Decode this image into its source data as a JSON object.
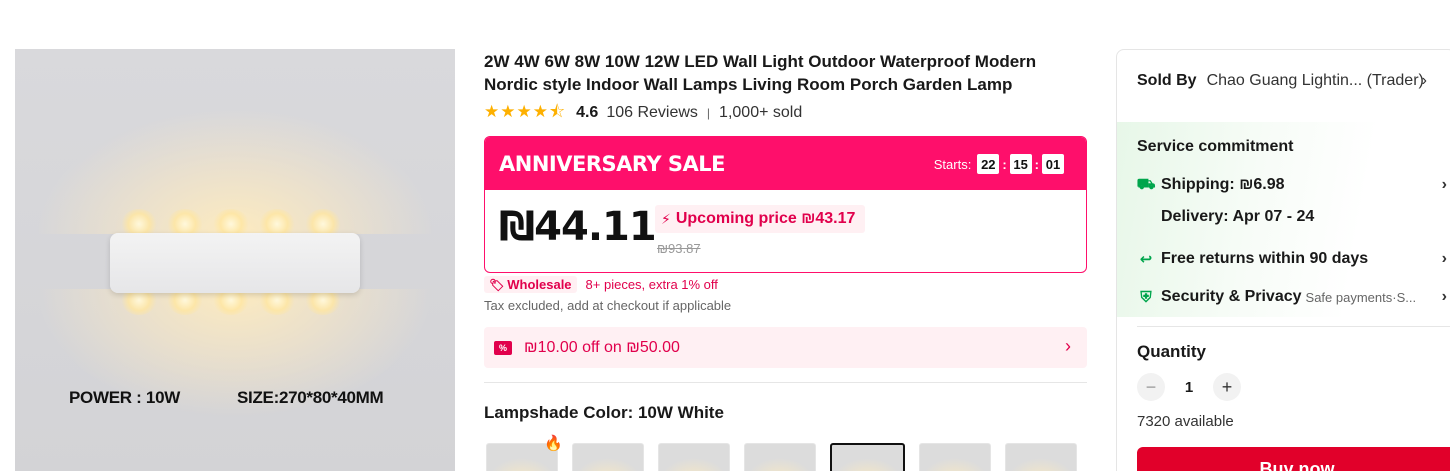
{
  "product_image": {
    "caption_power": "POWER : 10W",
    "caption_size": "SIZE:270*80*40MM"
  },
  "product": {
    "title": "2W 4W 6W 8W 10W 12W LED Wall Light Outdoor Waterproof Modern Nordic style Indoor Wall Lamps Living Room Porch Garden Lamp",
    "rating": 4.6,
    "rating_text": "4.6",
    "stars": "★★★★⯪",
    "reviews": "106 Reviews",
    "sold": "1,000+ sold"
  },
  "sale": {
    "banner": "ANNIVERSARY SALE",
    "starts_label": "Starts:",
    "hours": "22",
    "minutes": "15",
    "seconds": "01",
    "price": "₪44.11",
    "upcoming": "Upcoming price ₪43.17",
    "old_price": "₪93.87"
  },
  "wholesale": {
    "badge": "Wholesale",
    "text": "8+ pieces, extra 1% off"
  },
  "tax_note": "Tax excluded, add at checkout if applicable",
  "coupon": {
    "icon_text": "%",
    "text": "₪10.00 off on ₪50.00"
  },
  "color": {
    "label": "Lampshade Color: ",
    "value": "10W White",
    "selected_index": 4,
    "swatch_count": 7
  },
  "seller": {
    "label": "Sold By",
    "name": "Chao Guang Lightin... (Trader)"
  },
  "service": {
    "title": "Service commitment",
    "shipping": "Shipping: ₪6.98",
    "delivery": "Delivery: Apr 07 - 24",
    "returns": "Free returns within 90 days",
    "security": "Security & Privacy",
    "security_sub": "Safe payments·S..."
  },
  "quantity": {
    "label": "Quantity",
    "value": "1",
    "available": "7320 available"
  },
  "buy_button": "Buy now",
  "colors": {
    "accent": "#fe0f6b",
    "price_red": "#e1004c",
    "green": "#00a54c",
    "star": "#fdb000"
  }
}
